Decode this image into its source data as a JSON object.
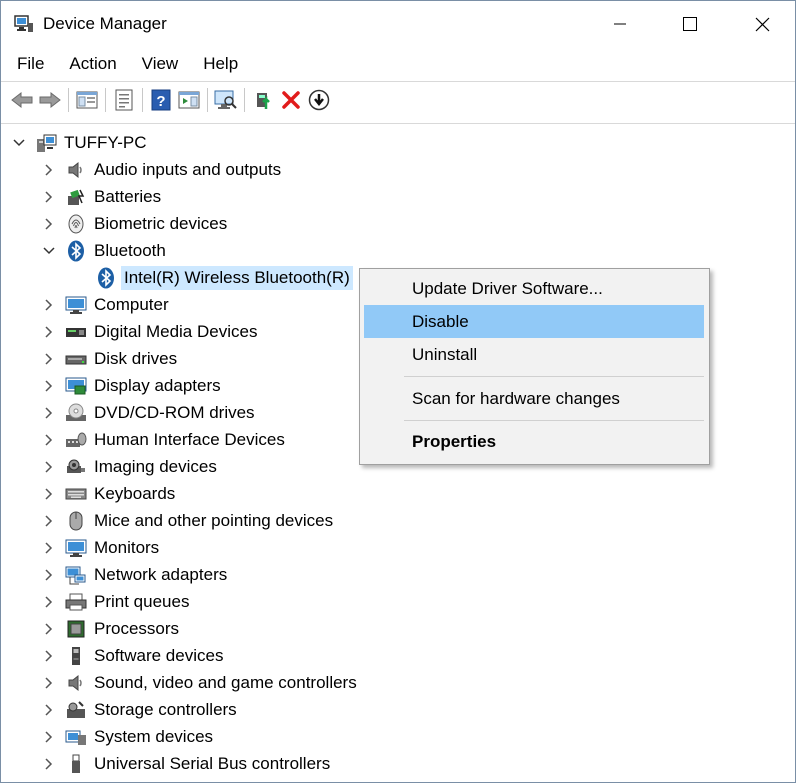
{
  "window": {
    "title": "Device Manager"
  },
  "menu": [
    "File",
    "Action",
    "View",
    "Help"
  ],
  "toolbar": {
    "buttons": [
      {
        "icon": "back-arrow-icon"
      },
      {
        "icon": "forward-arrow-icon"
      },
      {
        "icon": "show-hide-console-tree-icon"
      },
      {
        "icon": "properties-sheet-icon"
      },
      {
        "icon": "help-icon"
      },
      {
        "icon": "show-action-pane-icon"
      },
      {
        "icon": "scan-hardware-changes-icon"
      },
      {
        "icon": "update-driver-icon"
      },
      {
        "icon": "uninstall-device-icon"
      },
      {
        "icon": "disable-device-icon"
      }
    ]
  },
  "tree": {
    "root": "TUFFY-PC",
    "categories": [
      {
        "label": "Audio inputs and outputs",
        "icon": "speaker-icon"
      },
      {
        "label": "Batteries",
        "icon": "battery-icon"
      },
      {
        "label": "Biometric devices",
        "icon": "fingerprint-icon"
      },
      {
        "label": "Bluetooth",
        "icon": "bluetooth-icon",
        "expanded": true,
        "children": [
          {
            "label": "Intel(R) Wireless Bluetooth(R)",
            "icon": "bluetooth-icon"
          }
        ]
      },
      {
        "label": "Computer",
        "icon": "computer-icon"
      },
      {
        "label": "Digital Media Devices",
        "icon": "media-device-icon"
      },
      {
        "label": "Disk drives",
        "icon": "disk-drive-icon"
      },
      {
        "label": "Display adapters",
        "icon": "display-adapter-icon"
      },
      {
        "label": "DVD/CD-ROM drives",
        "icon": "dvd-drive-icon"
      },
      {
        "label": "Human Interface Devices",
        "icon": "hid-icon"
      },
      {
        "label": "Imaging devices",
        "icon": "camera-icon"
      },
      {
        "label": "Keyboards",
        "icon": "keyboard-icon"
      },
      {
        "label": "Mice and other pointing devices",
        "icon": "mouse-icon"
      },
      {
        "label": "Monitors",
        "icon": "monitor-icon"
      },
      {
        "label": "Network adapters",
        "icon": "network-icon"
      },
      {
        "label": "Print queues",
        "icon": "printer-icon"
      },
      {
        "label": "Processors",
        "icon": "processor-icon"
      },
      {
        "label": "Software devices",
        "icon": "software-device-icon"
      },
      {
        "label": "Sound, video and game controllers",
        "icon": "sound-icon"
      },
      {
        "label": "Storage controllers",
        "icon": "storage-controller-icon"
      },
      {
        "label": "System devices",
        "icon": "system-device-icon"
      },
      {
        "label": "Universal Serial Bus controllers",
        "icon": "usb-icon"
      }
    ]
  },
  "context_menu": {
    "items": [
      "Update Driver Software...",
      "Disable",
      "Uninstall",
      "Scan for hardware changes",
      "Properties"
    ],
    "highlighted": "Disable"
  },
  "colors": {
    "selection": "#cde8ff",
    "menu_highlight": "#91c9f7",
    "accent_blue": "#1e6fc4"
  }
}
